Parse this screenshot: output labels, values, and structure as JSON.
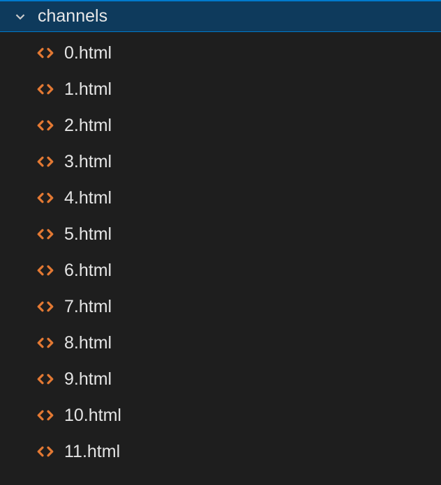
{
  "folder": {
    "name": "channels",
    "expanded": true
  },
  "files": [
    {
      "name": "0.html",
      "icon": "html-icon"
    },
    {
      "name": "1.html",
      "icon": "html-icon"
    },
    {
      "name": "2.html",
      "icon": "html-icon"
    },
    {
      "name": "3.html",
      "icon": "html-icon"
    },
    {
      "name": "4.html",
      "icon": "html-icon"
    },
    {
      "name": "5.html",
      "icon": "html-icon"
    },
    {
      "name": "6.html",
      "icon": "html-icon"
    },
    {
      "name": "7.html",
      "icon": "html-icon"
    },
    {
      "name": "8.html",
      "icon": "html-icon"
    },
    {
      "name": "9.html",
      "icon": "html-icon"
    },
    {
      "name": "10.html",
      "icon": "html-icon"
    },
    {
      "name": "11.html",
      "icon": "html-icon"
    }
  ]
}
